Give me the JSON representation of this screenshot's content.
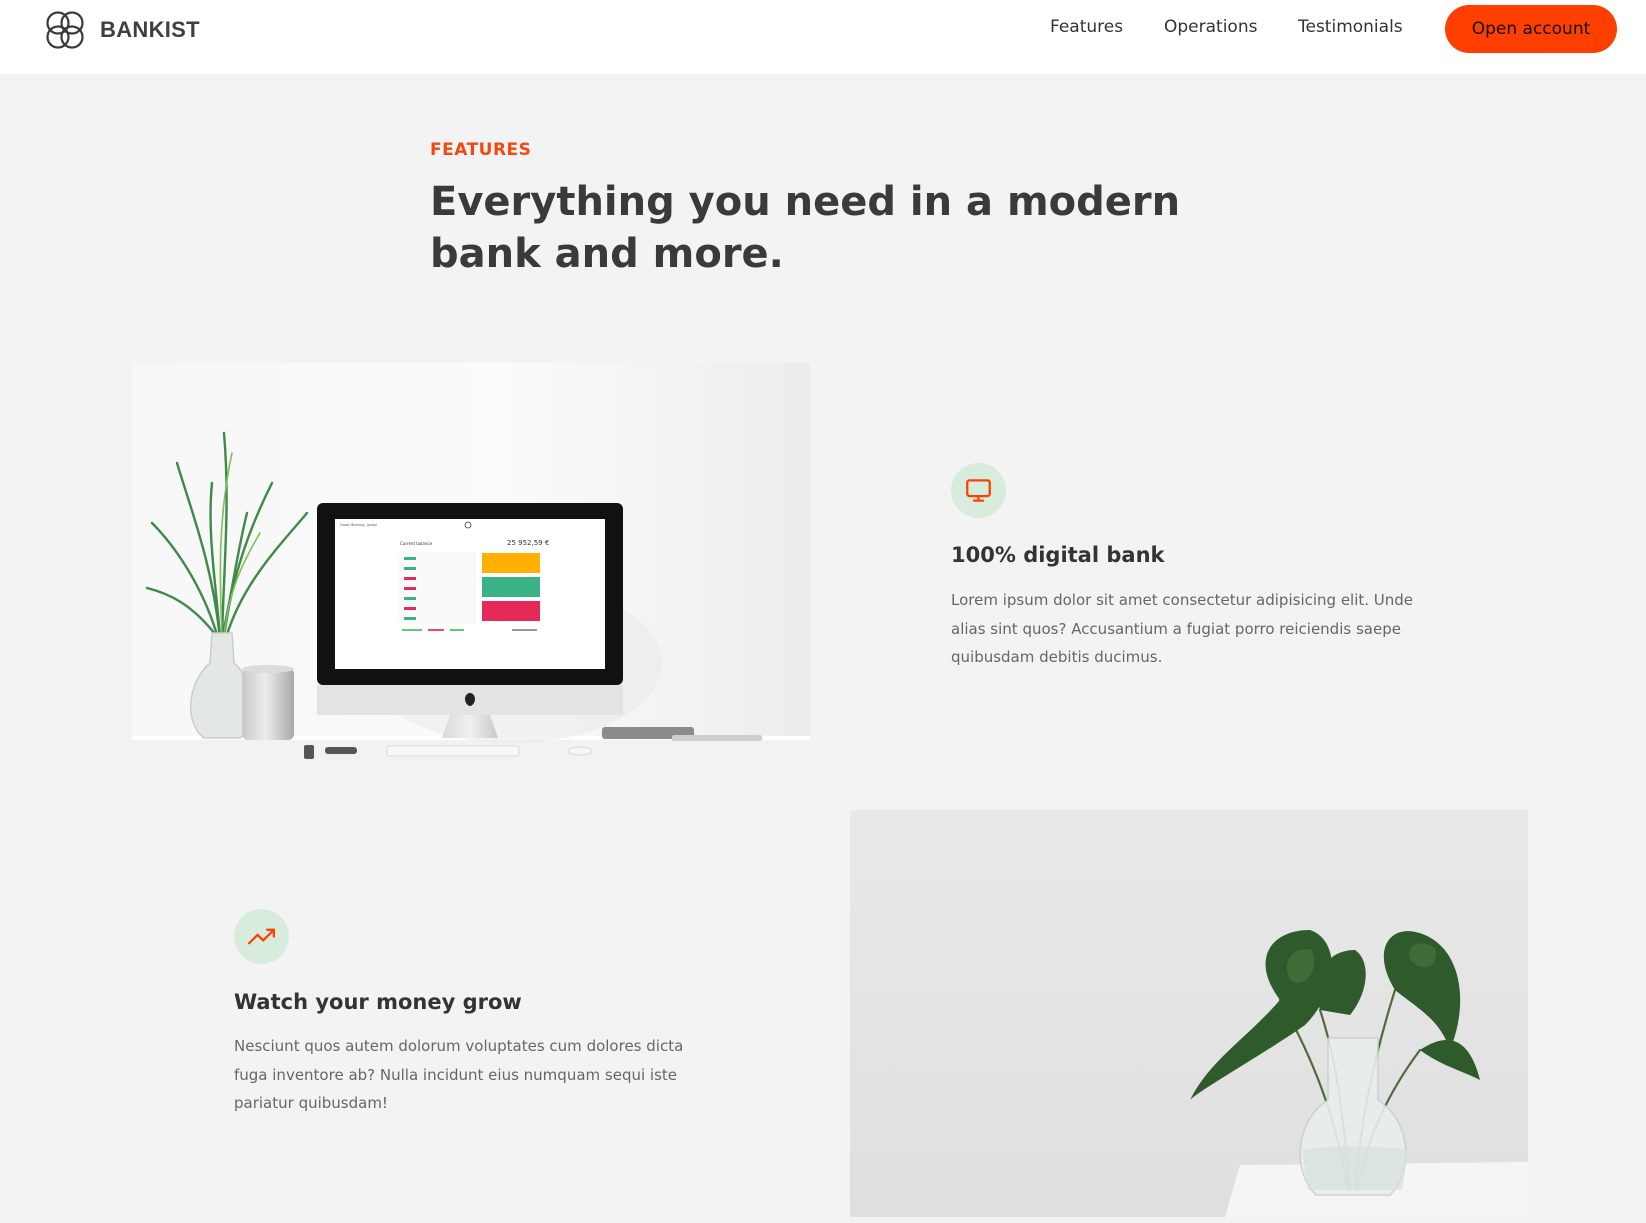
{
  "nav": {
    "brand": "BANKIST",
    "links": [
      "Features",
      "Operations",
      "Testimonials"
    ],
    "cta": "Open account"
  },
  "section": {
    "label": "FEATURES",
    "title": "Everything you need in a modern bank and more."
  },
  "features": [
    {
      "icon": "monitor-icon",
      "title": "100% digital bank",
      "text": "Lorem ipsum dolor sit amet consectetur adipisicing elit. Unde alias sint quos? Accusantium a fugiat porro reiciendis saepe quibusdam debitis ducimus."
    },
    {
      "icon": "trending-up-icon",
      "title": "Watch your money grow",
      "text": "Nesciunt quos autem dolorum voluptates cum dolores dicta fuga inventore ab? Nulla incidunt eius numquam sequi iste pariatur quibusdam!"
    }
  ],
  "screen": {
    "balance": "25 952,59 €"
  },
  "colors": {
    "accent": "#ff3f00",
    "accent_text": "#f04a12",
    "icon_bg": "#d7ecdd",
    "background": "#f3f3f3"
  }
}
